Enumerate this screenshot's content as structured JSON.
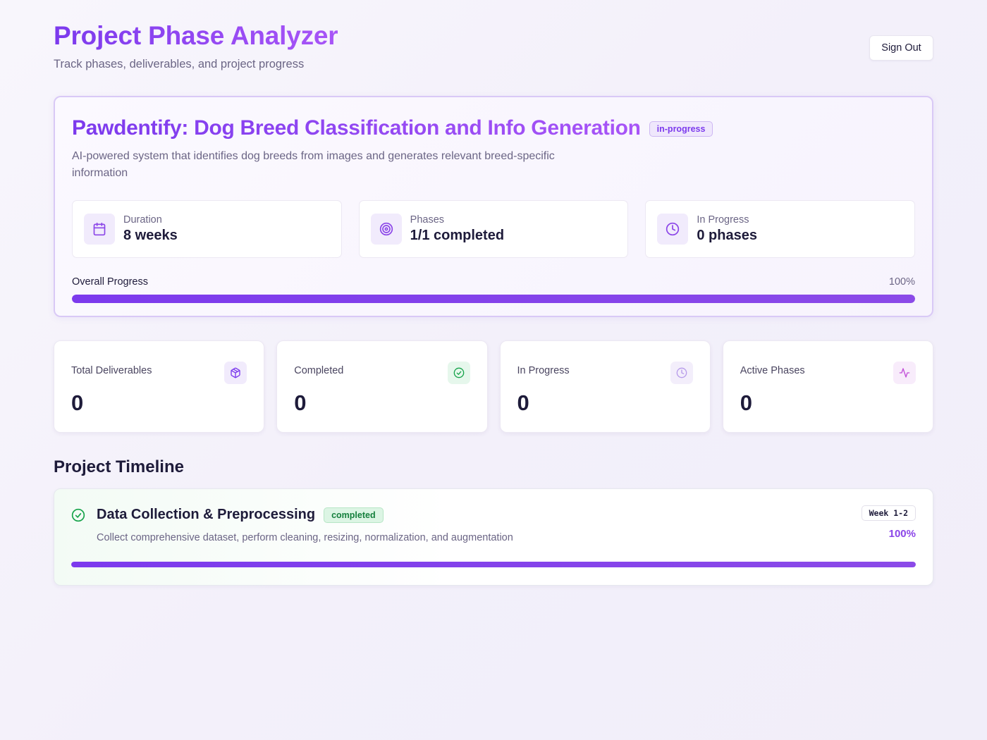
{
  "header": {
    "title": "Project Phase Analyzer",
    "subtitle": "Track phases, deliverables, and project progress",
    "signout_label": "Sign Out"
  },
  "project": {
    "title": "Pawdentify: Dog Breed Classification and Info Generation",
    "status": "in-progress",
    "description": "AI-powered system that identifies dog breeds from images and generates relevant breed-specific information",
    "stats": [
      {
        "label": "Duration",
        "value": "8 weeks",
        "icon": "calendar-icon"
      },
      {
        "label": "Phases",
        "value": "1/1 completed",
        "icon": "target-icon"
      },
      {
        "label": "In Progress",
        "value": "0 phases",
        "icon": "clock-icon"
      }
    ],
    "progress": {
      "label": "Overall Progress",
      "percent_text": "100%",
      "value": 100
    }
  },
  "metrics": [
    {
      "label": "Total Deliverables",
      "value": "0",
      "icon": "package-icon",
      "color": "#7c3aed"
    },
    {
      "label": "Completed",
      "value": "0",
      "icon": "check-circle-icon",
      "color": "#16a34a"
    },
    {
      "label": "In Progress",
      "value": "0",
      "icon": "clock-icon",
      "color": "#b79bea"
    },
    {
      "label": "Active Phases",
      "value": "0",
      "icon": "activity-icon",
      "color": "#c24fd8"
    }
  ],
  "timeline": {
    "title": "Project Timeline",
    "phases": [
      {
        "title": "Data Collection & Preprocessing",
        "status": "completed",
        "description": "Collect comprehensive dataset, perform cleaning, resizing, normalization, and augmentation",
        "week": "Week 1-2",
        "percent_text": "100%",
        "value": 100,
        "icon": "check-circle-icon"
      }
    ]
  },
  "colors": {
    "accent": "#7c3aed",
    "accent_light": "#a855f7",
    "success": "#16a34a"
  }
}
